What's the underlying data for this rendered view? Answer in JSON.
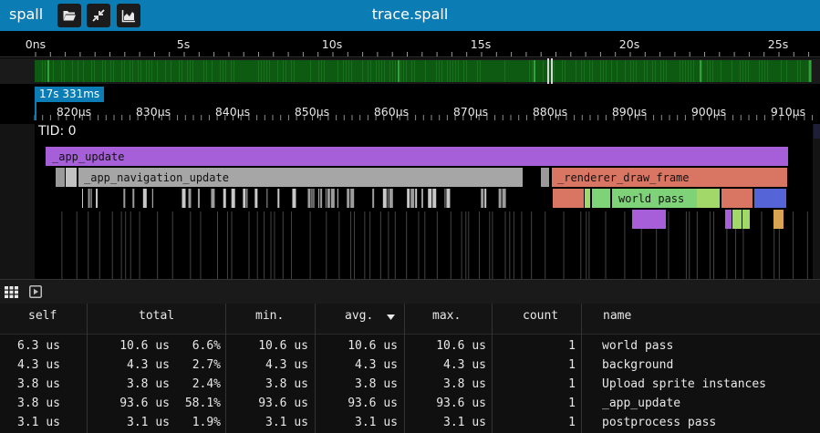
{
  "titlebar": {
    "app_name": "spall",
    "title": "trace.spall",
    "open_icon": "folder-open-icon",
    "compress_icon": "compress-arrows-icon",
    "stats_icon": "area-chart-icon",
    "bg_color": "#0b7cb4"
  },
  "overview": {
    "ticks": [
      "0ns",
      "5s",
      "10s",
      "15s",
      "20s",
      "25s"
    ],
    "minimap_color": "#0f5a12"
  },
  "timeline": {
    "cursor_label": "17s 331ms",
    "ticks": [
      "820µs",
      "830µs",
      "840µs",
      "850µs",
      "860µs",
      "870µs",
      "880µs",
      "890µs",
      "900µs",
      "910µs"
    ],
    "tid_label": "TID: 0",
    "slices": {
      "app_update": "_app_update",
      "navigation_update": "_app_navigation_update",
      "renderer_draw_frame": "_renderer_draw_frame",
      "world_pass": "world pass"
    },
    "colors": {
      "app_update": "#a65fd8",
      "navigation_update": "#a6a6a6",
      "renderer_draw_frame": "#d97563",
      "world_pass": "#7ed277",
      "light_green": "#a2d86a",
      "blue": "#5564d6",
      "orange": "#d9a452",
      "purple": "#a65fd8"
    }
  },
  "bottom_bar": {
    "grid_icon": "grid-icon",
    "play_icon": "play-square-icon"
  },
  "stats": {
    "columns": {
      "self": "self",
      "total": "total",
      "min": "min.",
      "avg": "avg.",
      "max": "max.",
      "count": "count",
      "name": "name"
    },
    "sort_icon": "sort-desc-icon",
    "rows": [
      {
        "self": "6.3 us",
        "total": "10.6 us",
        "total_pct": "6.6%",
        "min": "10.6 us",
        "avg": "10.6 us",
        "max": "10.6 us",
        "count": "1",
        "name": "world pass"
      },
      {
        "self": "4.3 us",
        "total": "4.3 us",
        "total_pct": "2.7%",
        "min": "4.3 us",
        "avg": "4.3 us",
        "max": "4.3 us",
        "count": "1",
        "name": "background"
      },
      {
        "self": "3.8 us",
        "total": "3.8 us",
        "total_pct": "2.4%",
        "min": "3.8 us",
        "avg": "3.8 us",
        "max": "3.8 us",
        "count": "1",
        "name": "Upload sprite instances"
      },
      {
        "self": "3.8 us",
        "total": "93.6 us",
        "total_pct": "58.1%",
        "min": "93.6 us",
        "avg": "93.6 us",
        "max": "93.6 us",
        "count": "1",
        "name": "_app_update"
      },
      {
        "self": "3.1 us",
        "total": "3.1 us",
        "total_pct": "1.9%",
        "min": "3.1 us",
        "avg": "3.1 us",
        "max": "3.1 us",
        "count": "1",
        "name": "postprocess pass"
      }
    ]
  }
}
